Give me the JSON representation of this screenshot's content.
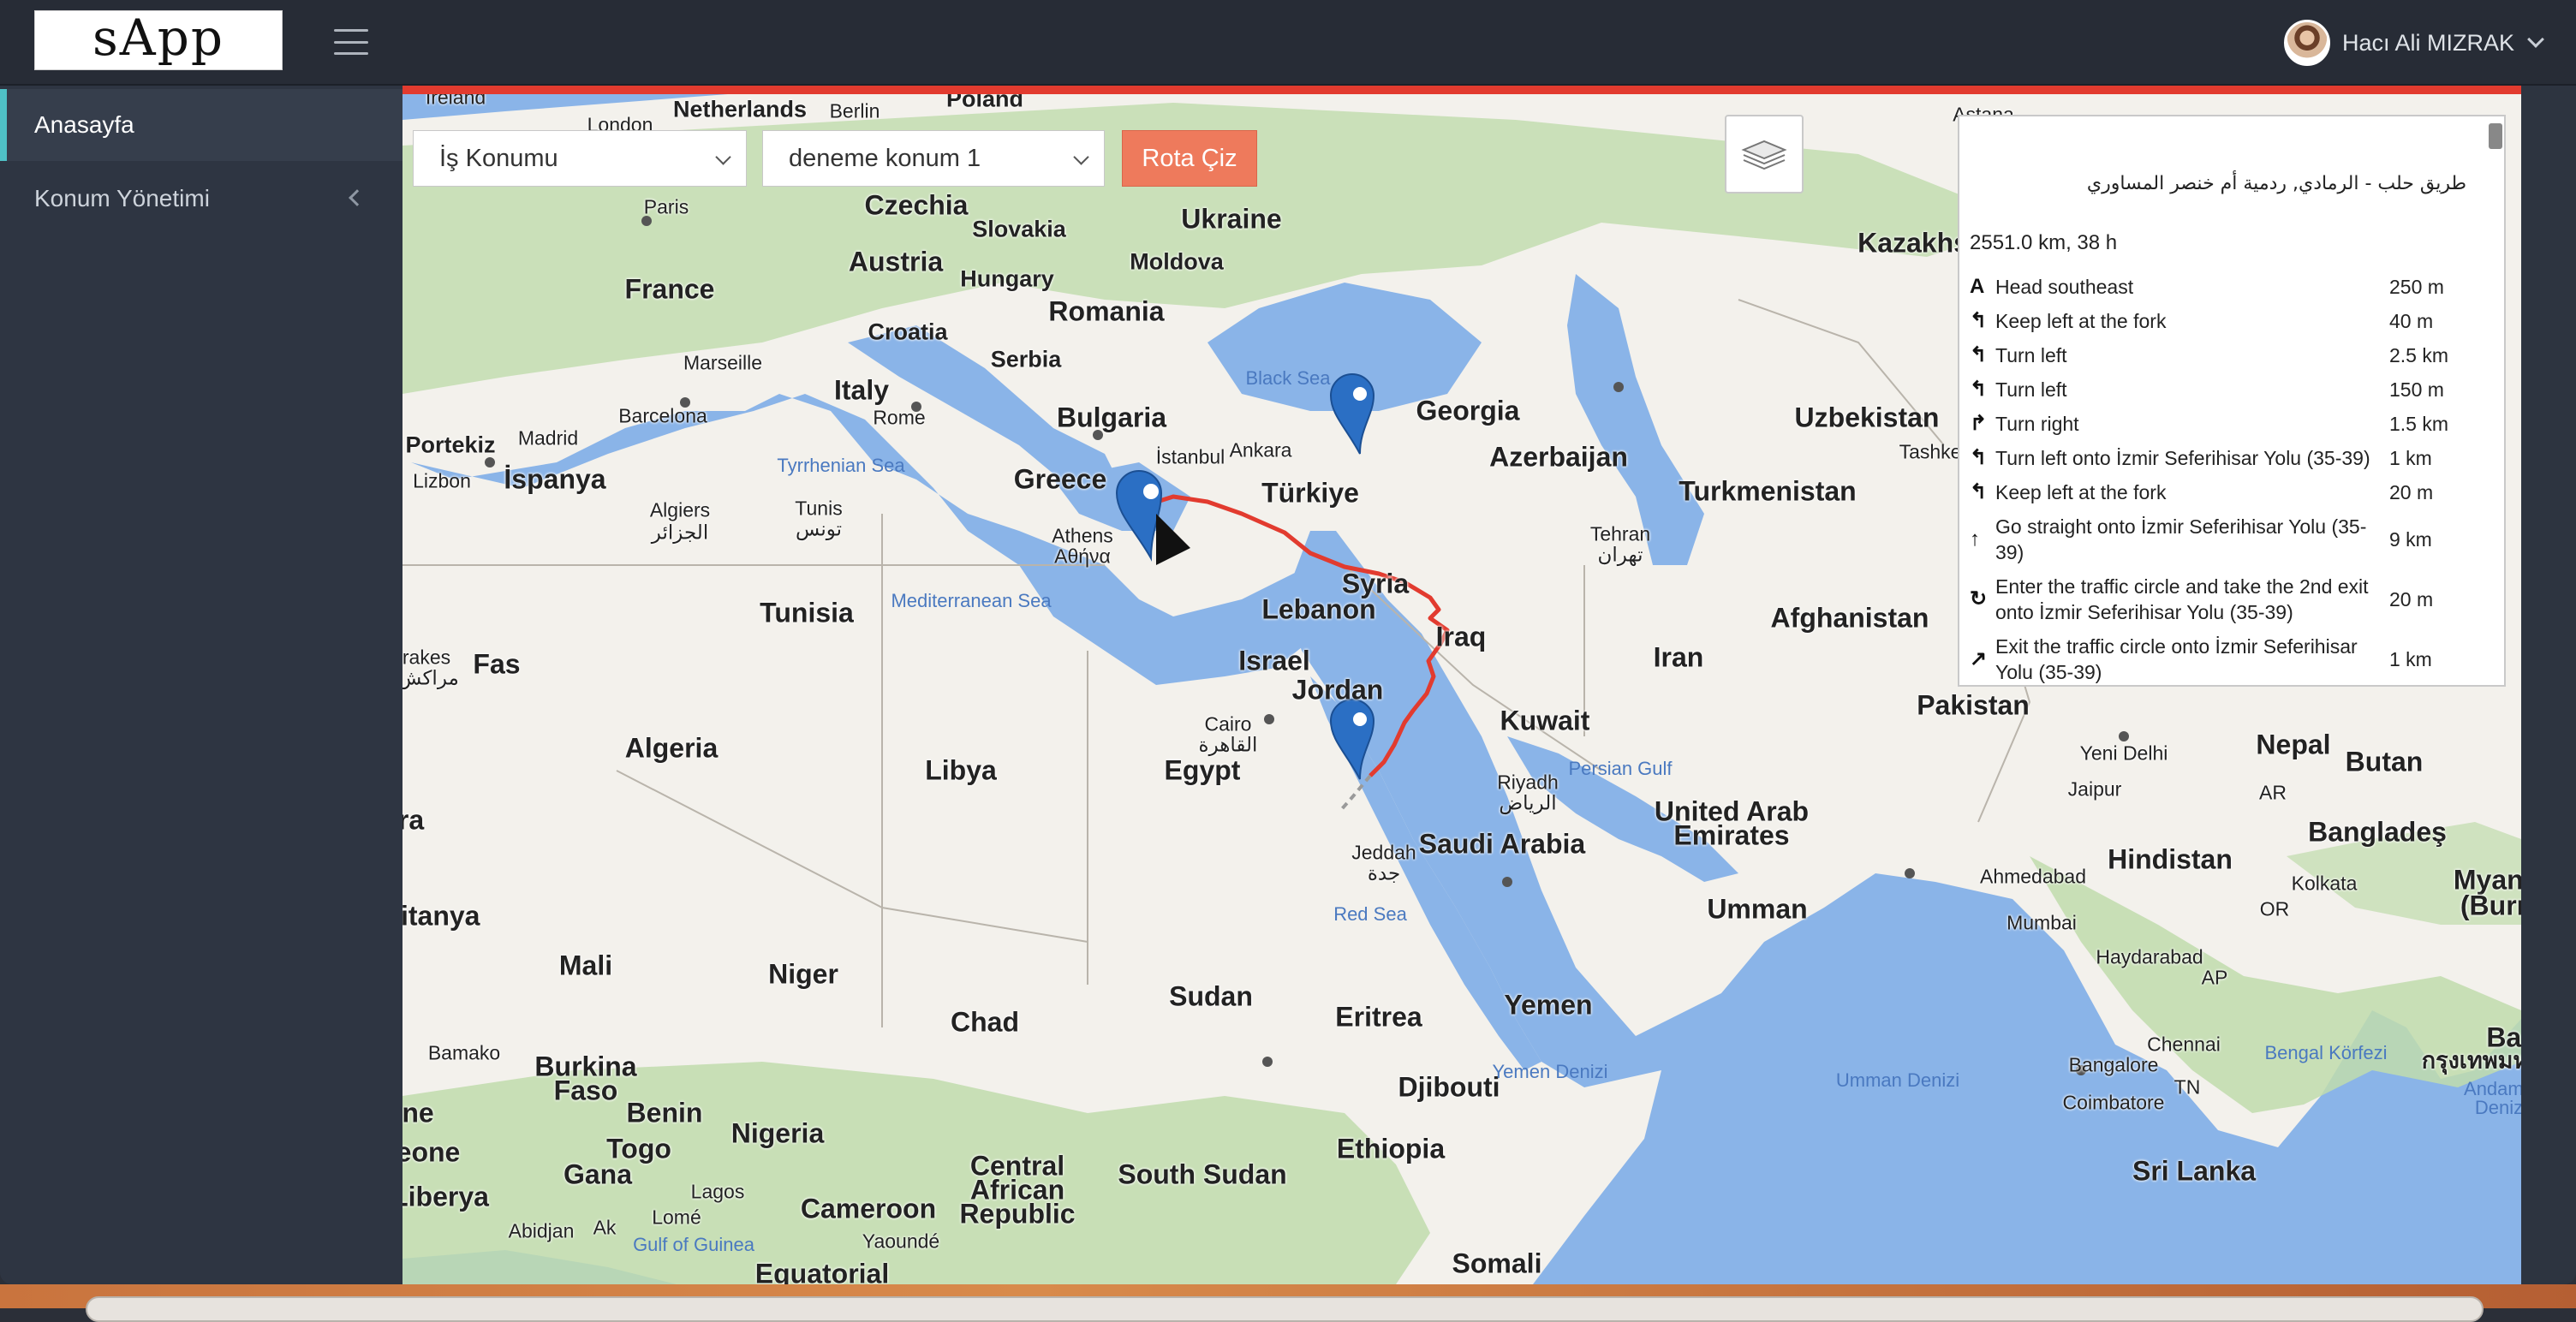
{
  "app": {
    "logo": "sApp"
  },
  "header": {
    "user_name": "Hacı Ali MIZRAK"
  },
  "sidebar": {
    "items": [
      {
        "label": "Anasayfa",
        "active": true
      },
      {
        "label": "Konum Yönetimi",
        "active": false
      }
    ]
  },
  "controls": {
    "location_type": "İş Konumu",
    "location": "deneme konum 1",
    "route_button": "Rota Çiz"
  },
  "directions": {
    "title": "طريق حلب - الرمادي, ردمية أم خنصر المساوري",
    "summary": "2551.0 km, 38 h",
    "steps": [
      {
        "icon": "A",
        "text": "Head southeast",
        "distance": "250 m"
      },
      {
        "icon": "↰",
        "text": "Keep left at the fork",
        "distance": "40 m"
      },
      {
        "icon": "↰",
        "text": "Turn left",
        "distance": "2.5 km"
      },
      {
        "icon": "↰",
        "text": "Turn left",
        "distance": "150 m"
      },
      {
        "icon": "↱",
        "text": "Turn right",
        "distance": "1.5 km"
      },
      {
        "icon": "↰",
        "text": "Turn left onto İzmir Seferihisar Yolu (35-39)",
        "distance": "1 km"
      },
      {
        "icon": "↰",
        "text": "Keep left at the fork",
        "distance": "20 m"
      },
      {
        "icon": "↑",
        "text": "Go straight onto İzmir Seferihisar Yolu (35-39)",
        "distance": "9 km"
      },
      {
        "icon": "↻",
        "text": "Enter the traffic circle and take the 2nd exit onto İzmir Seferihisar Yolu (35-39)",
        "distance": "20 m"
      },
      {
        "icon": "↗",
        "text": "Exit the traffic circle onto İzmir Seferihisar Yolu (35-39)",
        "distance": "1 km"
      }
    ]
  },
  "map": {
    "labels": {
      "ireland": "Ireland",
      "london": "London",
      "netherlands": "Netherlands",
      "berlin": "Berlin",
      "poland": "Poland",
      "paris": "Paris",
      "czechia": "Czechia",
      "slovakia": "Slovakia",
      "ukraine": "Ukraine",
      "austria": "Austria",
      "moldova": "Moldova",
      "hungary": "Hungary",
      "france": "France",
      "romania": "Romania",
      "croatia": "Croatia",
      "marseille": "Marseille",
      "serbia": "Serbia",
      "italy": "Italy",
      "black_sea": "Black Sea",
      "georgia": "Georgia",
      "barcelona": "Barcelona",
      "bulgaria": "Bulgaria",
      "rome": "Rome",
      "istanbul": "İstanbul",
      "ankara": "Ankara",
      "portekiz": "Portekiz",
      "madrid": "Madrid",
      "uzbekistan": "Uzbekistan",
      "tashkent": "Tashke",
      "azerbaijan": "Azerbaijan",
      "lizbon": "Lizbon",
      "ispanya": "İspanya",
      "tyrrhenian": "Tyrrhenian Sea",
      "greece": "Greece",
      "turkiye": "Türkiye",
      "turkmenistan": "Turkmenistan",
      "algiers": "Algiers",
      "algiers_ar": "الجزائر",
      "tunis": "Tunis",
      "tunis_ar": "تونس",
      "athens": "Athens",
      "athens_gr": "Αθήνα",
      "tehran": "Tehran",
      "tehran_fa": "تهران",
      "syria": "Syria",
      "mediterranean": "Mediterranean Sea",
      "tunisia": "Tunisia",
      "lebanon": "Lebanon",
      "iraq": "Iraq",
      "afghanistan": "Afghanistan",
      "rakes": "rakes",
      "fas": "Fas",
      "rakes_ar": "مراكش",
      "israel": "Israel",
      "iran": "Iran",
      "pakistan": "Pakistan",
      "jordan": "Jordan",
      "kuwait": "Kuwait",
      "cairo": "Cairo",
      "cairo_ar": "القاهرة",
      "algeria": "Algeria",
      "libya": "Libya",
      "egypt": "Egypt",
      "yeni_delhi": "Yeni Delhi",
      "nepal": "Nepal",
      "butan": "Butan",
      "jaipur": "Jaipur",
      "persian_gulf": "Persian Gulf",
      "riyadh": "Riyadh",
      "riyadh_ar": "الرياض",
      "uae": "United Arab",
      "uae2": "Emirates",
      "saudi": "Saudi Arabia",
      "hindistan": "Hindistan",
      "banglades": "Bangladeş",
      "ahmedabad": "Ahmedabad",
      "kolkata": "Kolkata",
      "myanmar": "Myanm",
      "myanmar2": "(Burm",
      "jeddah": "Jeddah",
      "jeddah_ar": "جدة",
      "red_sea": "Red Sea",
      "umman": "Umman",
      "mumbai": "Mumbai",
      "ritanya": "ritanya",
      "mali": "Mali",
      "niger": "Niger",
      "sudan": "Sudan",
      "chad": "Chad",
      "haydarabad": "Haydarabad",
      "eritrea": "Eritrea",
      "yemen": "Yemen",
      "bamako": "Bamako",
      "burkina": "Burkina",
      "faso": "Faso",
      "djibouti": "Djibouti",
      "yemen_denizi": "Yemen Denizi",
      "chennai": "Chennai",
      "bangalore": "Bangalore",
      "bengal": "Bengal Körfezi",
      "thai": "กรุงเทพมห",
      "umman_denizi": "Umman Denizi",
      "coimbatore": "Coimbatore",
      "benin": "Benin",
      "nigeria": "Nigeria",
      "ethiopia": "Ethiopia",
      "andaman": "Andama",
      "andaman2": "Deniz",
      "togo": "Togo",
      "gana": "Gana",
      "ne": "ne",
      "eone": "eone",
      "lagos": "Lagos",
      "central1": "Central",
      "central2": "African",
      "central3": "Republic",
      "south_sudan": "South Sudan",
      "sri_lanka": "Sri Lanka",
      "liberya": "Liberya",
      "abidjan": "Abidjan",
      "ak": "Ak",
      "lome": "Lomé",
      "cameroon": "Cameroon",
      "yaounde": "Yaoundé",
      "gulf_guinea": "Gulf of Guinea",
      "equatorial": "Equatorial",
      "somali": "Somali",
      "kazakh": "Kazakhs",
      "astana": "Astana",
      "a_left": "a",
      "ra": "ra",
      "kurul": "TN",
      "ap": "AP",
      "or": "OR",
      "ar": "AR",
      "bar": "Bar"
    }
  },
  "colors": {
    "accent": "#4fc1c6",
    "route_button": "#ee7a5c",
    "route_line": "#e23b2f",
    "sea": "#8ab4e8",
    "land": "#f3f1ec",
    "green": "#bfdcad"
  }
}
